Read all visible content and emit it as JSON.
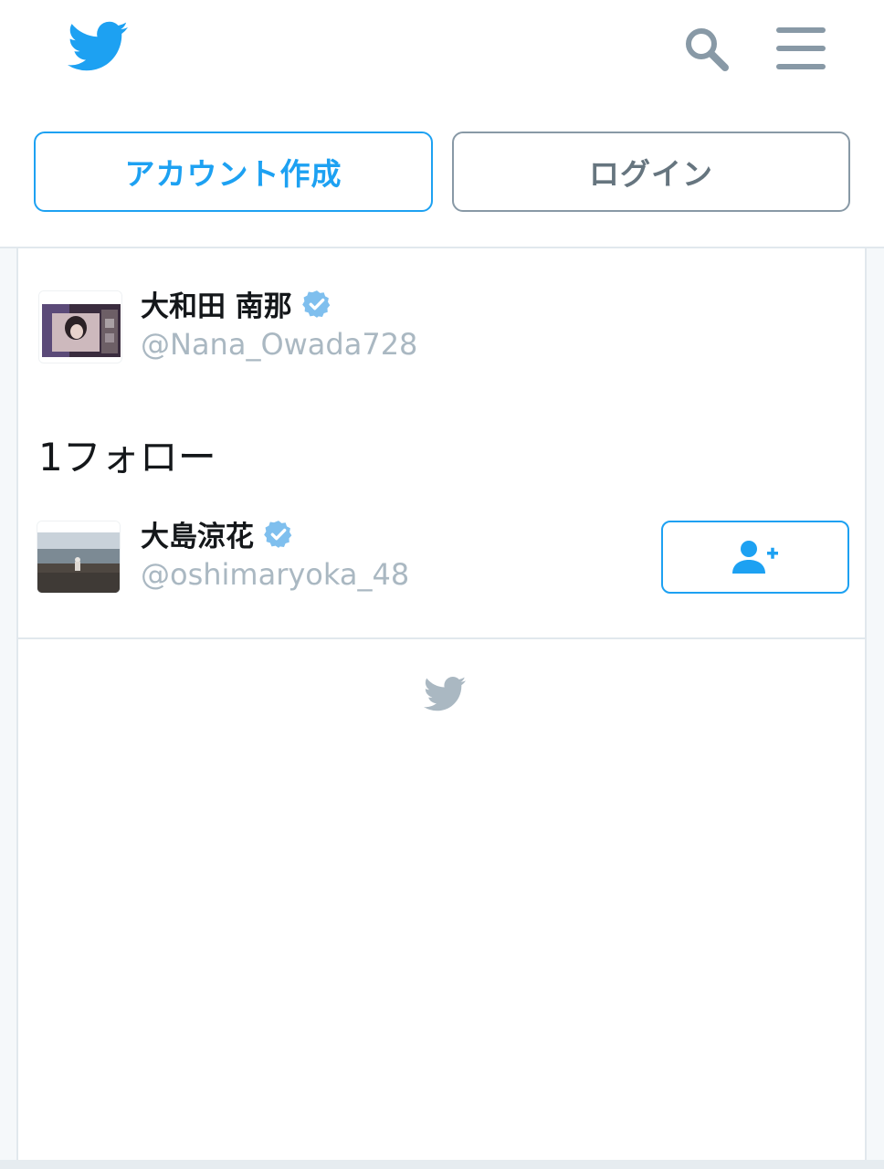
{
  "header": {
    "signup_label": "アカウント作成",
    "login_label": "ログイン"
  },
  "profile": {
    "name": "大和田 南那",
    "handle": "@Nana_Owada728",
    "verified": true
  },
  "following": {
    "count_label": "1フォロー",
    "items": [
      {
        "name": "大島涼花",
        "handle": "@oshimaryoka_48",
        "verified": true
      }
    ]
  },
  "colors": {
    "brand": "#1da1f2",
    "verified": "#7fbfee",
    "icon_gray": "#8899a6",
    "handle_gray": "#aab8c2",
    "footer_bird": "#aab8c2"
  },
  "icons": {
    "logo": "twitter-bird-icon",
    "search": "search-icon",
    "menu": "hamburger-menu-icon",
    "verified": "verified-badge-icon",
    "follow": "add-user-icon",
    "footer": "twitter-bird-icon"
  }
}
